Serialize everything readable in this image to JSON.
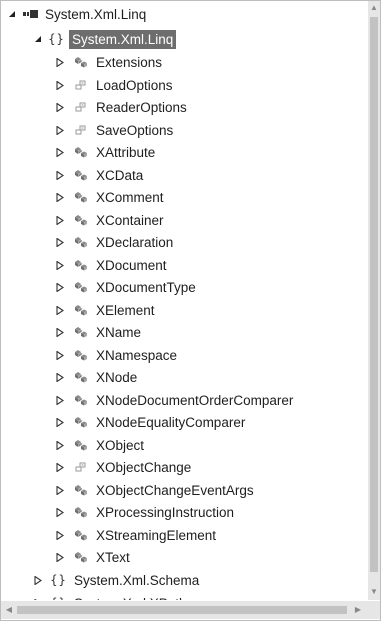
{
  "tree": {
    "assembly": {
      "label": "System.Xml.Linq",
      "icon": "assembly-icon",
      "expanded": true
    },
    "namespace": {
      "label": "System.Xml.Linq",
      "icon": "namespace-icon",
      "expanded": true,
      "selected": true
    },
    "types": [
      {
        "label": "Extensions",
        "icon": "class-icon"
      },
      {
        "label": "LoadOptions",
        "icon": "enum-icon"
      },
      {
        "label": "ReaderOptions",
        "icon": "enum-icon"
      },
      {
        "label": "SaveOptions",
        "icon": "enum-icon"
      },
      {
        "label": "XAttribute",
        "icon": "class-icon"
      },
      {
        "label": "XCData",
        "icon": "class-icon"
      },
      {
        "label": "XComment",
        "icon": "class-icon"
      },
      {
        "label": "XContainer",
        "icon": "class-icon"
      },
      {
        "label": "XDeclaration",
        "icon": "class-icon"
      },
      {
        "label": "XDocument",
        "icon": "class-icon"
      },
      {
        "label": "XDocumentType",
        "icon": "class-icon"
      },
      {
        "label": "XElement",
        "icon": "class-icon"
      },
      {
        "label": "XName",
        "icon": "class-icon"
      },
      {
        "label": "XNamespace",
        "icon": "class-icon"
      },
      {
        "label": "XNode",
        "icon": "class-icon"
      },
      {
        "label": "XNodeDocumentOrderComparer",
        "icon": "class-icon"
      },
      {
        "label": "XNodeEqualityComparer",
        "icon": "class-icon"
      },
      {
        "label": "XObject",
        "icon": "class-icon"
      },
      {
        "label": "XObjectChange",
        "icon": "enum-icon"
      },
      {
        "label": "XObjectChangeEventArgs",
        "icon": "class-icon"
      },
      {
        "label": "XProcessingInstruction",
        "icon": "class-icon"
      },
      {
        "label": "XStreamingElement",
        "icon": "class-icon"
      },
      {
        "label": "XText",
        "icon": "class-icon"
      }
    ],
    "siblings": [
      {
        "label": "System.Xml.Schema",
        "icon": "namespace-icon"
      },
      {
        "label": "System.Xml.XPath",
        "icon": "namespace-icon"
      }
    ]
  },
  "colors": {
    "selection_bg": "#6d6d6d",
    "selection_fg": "#ffffff",
    "icon_gray": "#8a8a8a",
    "icon_dark": "#3a3a3a"
  }
}
